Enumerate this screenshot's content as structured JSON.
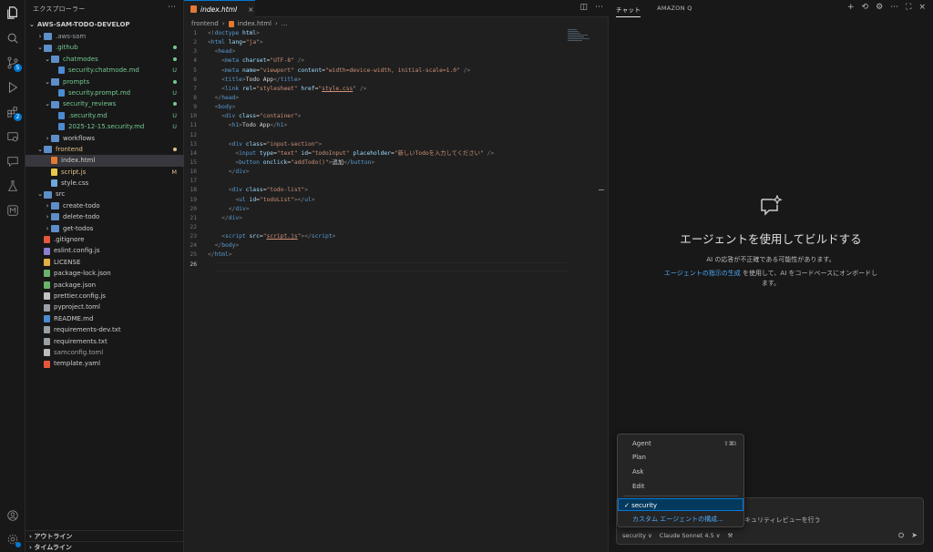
{
  "sidebar": {
    "title": "エクスプローラー",
    "root": "AWS-SAM-TODO-DEVELOP",
    "items": [
      {
        "label": ".aws-sam",
        "depth": 1,
        "kind": "folder",
        "open": false,
        "status": "",
        "color": "#9aa0a6"
      },
      {
        "label": ".github",
        "depth": 1,
        "kind": "folder",
        "open": true,
        "status": "dot",
        "color": "#73c991"
      },
      {
        "label": "chatmodes",
        "depth": 2,
        "kind": "folder",
        "open": true,
        "status": "dot",
        "color": "#73c991"
      },
      {
        "label": "security.chatmode.md",
        "depth": 3,
        "kind": "md",
        "status": "U",
        "color": "#73c991"
      },
      {
        "label": "prompts",
        "depth": 2,
        "kind": "folder",
        "open": true,
        "status": "dot",
        "color": "#73c991"
      },
      {
        "label": "security.prompt.md",
        "depth": 3,
        "kind": "md",
        "status": "U",
        "color": "#73c991"
      },
      {
        "label": "security_reviews",
        "depth": 2,
        "kind": "folder",
        "open": true,
        "status": "dot",
        "color": "#73c991"
      },
      {
        "label": ".security.md",
        "depth": 3,
        "kind": "md",
        "status": "U",
        "color": "#73c991"
      },
      {
        "label": "2025-12-15.security.md",
        "depth": 3,
        "kind": "md",
        "status": "U",
        "color": "#73c991"
      },
      {
        "label": "workflows",
        "depth": 2,
        "kind": "folder",
        "open": false,
        "status": "",
        "color": "#cccccc"
      },
      {
        "label": "frontend",
        "depth": 1,
        "kind": "folder",
        "open": true,
        "status": "dot",
        "color": "#e2c08d"
      },
      {
        "label": "index.html",
        "depth": 2,
        "kind": "html",
        "status": "",
        "color": "#cccccc",
        "selected": true
      },
      {
        "label": "script.js",
        "depth": 2,
        "kind": "js",
        "status": "M",
        "color": "#e2c08d"
      },
      {
        "label": "style.css",
        "depth": 2,
        "kind": "css",
        "status": "",
        "color": "#cccccc"
      },
      {
        "label": "src",
        "depth": 1,
        "kind": "folder",
        "open": true,
        "status": "",
        "color": "#cccccc"
      },
      {
        "label": "create-todo",
        "depth": 2,
        "kind": "folder",
        "open": false,
        "status": "",
        "color": "#cccccc"
      },
      {
        "label": "delete-todo",
        "depth": 2,
        "kind": "folder",
        "open": false,
        "status": "",
        "color": "#cccccc"
      },
      {
        "label": "get-todos",
        "depth": 2,
        "kind": "folder",
        "open": false,
        "status": "",
        "color": "#cccccc"
      },
      {
        "label": ".gitignore",
        "depth": 1,
        "kind": "git",
        "status": "",
        "color": "#cccccc"
      },
      {
        "label": "eslint.config.js",
        "depth": 1,
        "kind": "eslint",
        "status": "",
        "color": "#cccccc"
      },
      {
        "label": "LICENSE",
        "depth": 1,
        "kind": "license",
        "status": "",
        "color": "#cccccc"
      },
      {
        "label": "package-lock.json",
        "depth": 1,
        "kind": "npm",
        "status": "",
        "color": "#cccccc"
      },
      {
        "label": "package.json",
        "depth": 1,
        "kind": "npm",
        "status": "",
        "color": "#cccccc"
      },
      {
        "label": "prettier.config.js",
        "depth": 1,
        "kind": "prettier",
        "status": "",
        "color": "#cccccc"
      },
      {
        "label": "pyproject.toml",
        "depth": 1,
        "kind": "toml",
        "status": "",
        "color": "#cccccc"
      },
      {
        "label": "README.md",
        "depth": 1,
        "kind": "info",
        "status": "",
        "color": "#cccccc"
      },
      {
        "label": "requirements-dev.txt",
        "depth": 1,
        "kind": "txt",
        "status": "",
        "color": "#cccccc"
      },
      {
        "label": "requirements.txt",
        "depth": 1,
        "kind": "txt",
        "status": "",
        "color": "#cccccc"
      },
      {
        "label": "samconfig.toml",
        "depth": 1,
        "kind": "toml-t",
        "status": "",
        "color": "#9aa0a6"
      },
      {
        "label": "template.yaml",
        "depth": 1,
        "kind": "yaml",
        "status": "",
        "color": "#cccccc"
      }
    ],
    "outline": "アウトライン",
    "timeline": "タイムライン"
  },
  "activity": {
    "badge_scm": "5",
    "badge_ext": "2"
  },
  "editor": {
    "tab_label": "index.html",
    "breadcrumb": [
      "frontend",
      "index.html",
      "..."
    ],
    "lines": [
      {
        "n": "1",
        "html": "<span class='pu'>&lt;!</span><span class='tg'>doctype</span> <span class='at'>html</span><span class='pu'>&gt;</span>"
      },
      {
        "n": "2",
        "html": "<span class='pu'>&lt;</span><span class='tg'>html</span> <span class='at'>lang</span><span class='tx'>=</span><span class='st'>\"ja\"</span><span class='pu'>&gt;</span>"
      },
      {
        "n": "3",
        "html": "  <span class='pu'>&lt;</span><span class='tg'>head</span><span class='pu'>&gt;</span>"
      },
      {
        "n": "4",
        "html": "    <span class='pu'>&lt;</span><span class='tg'>meta</span> <span class='at'>charset</span><span class='tx'>=</span><span class='st'>\"UTF-8\"</span> <span class='pu'>/&gt;</span>"
      },
      {
        "n": "5",
        "html": "    <span class='pu'>&lt;</span><span class='tg'>meta</span> <span class='at'>name</span><span class='tx'>=</span><span class='st'>\"viewport\"</span> <span class='at'>content</span><span class='tx'>=</span><span class='st'>\"width=device-width, initial-scale=1.0\"</span> <span class='pu'>/&gt;</span>"
      },
      {
        "n": "6",
        "html": "    <span class='pu'>&lt;</span><span class='tg'>title</span><span class='pu'>&gt;</span><span class='tx'>Todo App</span><span class='pu'>&lt;/</span><span class='tg'>title</span><span class='pu'>&gt;</span>"
      },
      {
        "n": "7",
        "html": "    <span class='pu'>&lt;</span><span class='tg'>link</span> <span class='at'>rel</span><span class='tx'>=</span><span class='st'>\"stylesheet\"</span> <span class='at'>href</span><span class='tx'>=</span><span class='st'>\"<span class='ul'>style.css</span>\"</span> <span class='pu'>/&gt;</span>"
      },
      {
        "n": "8",
        "html": "  <span class='pu'>&lt;/</span><span class='tg'>head</span><span class='pu'>&gt;</span>"
      },
      {
        "n": "9",
        "html": "  <span class='pu'>&lt;</span><span class='tg'>body</span><span class='pu'>&gt;</span>"
      },
      {
        "n": "10",
        "html": "    <span class='pu'>&lt;</span><span class='tg'>div</span> <span class='at'>class</span><span class='tx'>=</span><span class='st'>\"container\"</span><span class='pu'>&gt;</span>"
      },
      {
        "n": "11",
        "html": "      <span class='pu'>&lt;</span><span class='tg'>h1</span><span class='pu'>&gt;</span><span class='tx'>Todo App</span><span class='pu'>&lt;/</span><span class='tg'>h1</span><span class='pu'>&gt;</span>"
      },
      {
        "n": "12",
        "html": ""
      },
      {
        "n": "13",
        "html": "      <span class='pu'>&lt;</span><span class='tg'>div</span> <span class='at'>class</span><span class='tx'>=</span><span class='st'>\"input-section\"</span><span class='pu'>&gt;</span>"
      },
      {
        "n": "14",
        "html": "        <span class='pu'>&lt;</span><span class='tg'>input</span> <span class='at'>type</span><span class='tx'>=</span><span class='st'>\"text\"</span> <span class='at'>id</span><span class='tx'>=</span><span class='st'>\"todoInput\"</span> <span class='at'>placeholder</span><span class='tx'>=</span><span class='st'>\"新しいTodoを入力してください\"</span> <span class='pu'>/&gt;</span>"
      },
      {
        "n": "15",
        "html": "        <span class='pu'>&lt;</span><span class='tg'>button</span> <span class='at'>onclick</span><span class='tx'>=</span><span class='st'>\"addTodo()\"</span><span class='pu'>&gt;</span><span class='tx'>追加</span><span class='pu'>&lt;/</span><span class='tg'>button</span><span class='pu'>&gt;</span>"
      },
      {
        "n": "16",
        "html": "      <span class='pu'>&lt;/</span><span class='tg'>div</span><span class='pu'>&gt;</span>"
      },
      {
        "n": "17",
        "html": ""
      },
      {
        "n": "18",
        "html": "      <span class='pu'>&lt;</span><span class='tg'>div</span> <span class='at'>class</span><span class='tx'>=</span><span class='st'>\"todo-list\"</span><span class='pu'>&gt;</span>"
      },
      {
        "n": "19",
        "html": "        <span class='pu'>&lt;</span><span class='tg'>ul</span> <span class='at'>id</span><span class='tx'>=</span><span class='st'>\"todoList\"</span><span class='pu'>&gt;&lt;/</span><span class='tg'>ul</span><span class='pu'>&gt;</span>"
      },
      {
        "n": "20",
        "html": "      <span class='pu'>&lt;/</span><span class='tg'>div</span><span class='pu'>&gt;</span>"
      },
      {
        "n": "21",
        "html": "    <span class='pu'>&lt;/</span><span class='tg'>div</span><span class='pu'>&gt;</span>"
      },
      {
        "n": "22",
        "html": ""
      },
      {
        "n": "23",
        "html": "    <span class='pu'>&lt;</span><span class='tg'>script</span> <span class='at'>src</span><span class='tx'>=</span><span class='st'>\"<span class='ul'>script.js</span>\"</span><span class='pu'>&gt;&lt;/</span><span class='tg'>script</span><span class='pu'>&gt;</span>"
      },
      {
        "n": "24",
        "html": "  <span class='pu'>&lt;/</span><span class='tg'>body</span><span class='pu'>&gt;</span>"
      },
      {
        "n": "25",
        "html": "<span class='pu'>&lt;/</span><span class='tg'>html</span><span class='pu'>&gt;</span>"
      },
      {
        "n": "26",
        "html": "",
        "active": true
      }
    ]
  },
  "chat": {
    "tab_chat": "チャット",
    "tab_q": "AMAZON Q",
    "empty_title": "エージェントを使用してビルドする",
    "empty_sub": "AI の応答が不正確である可能性があります。",
    "empty_link": "エージェントの指示の生成",
    "empty_rest": " を使用して、AI をコードベースにオンボードします。",
    "input_hint": "キュリティレビューを行う",
    "mode_label": "security ∨",
    "model_label": "Claude Sonnet 4.5 ∨",
    "menu": {
      "agent": "Agent",
      "agent_kbd": "⇧⌘I",
      "plan": "Plan",
      "ask": "Ask",
      "edit": "Edit",
      "security": "✓ security",
      "custom": "カスタム エージェントの構成..."
    }
  },
  "colors": {
    "accent": "#0078d4",
    "link": "#4daafc"
  }
}
